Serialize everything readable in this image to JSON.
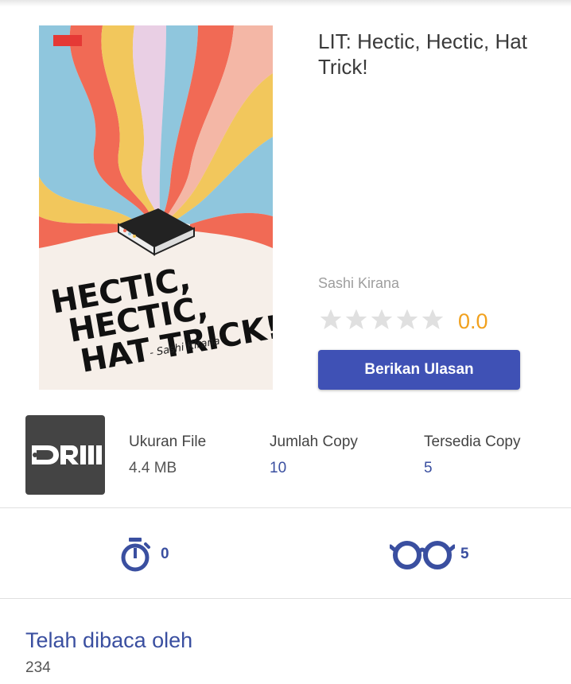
{
  "book": {
    "title": "LIT: Hectic, Hectic, Hat Trick!",
    "author": "Sashi Kirana",
    "rating": "0.0",
    "stars_filled": 0,
    "stars_total": 5,
    "review_button": "Berikan Ulasan",
    "cover": {
      "title_lines": [
        "HECTIC,",
        "HECTIC,",
        "HAT TRICK!"
      ],
      "author_line": "- Sashi Kirana",
      "publisher_logo": "gramedia-logo",
      "colors": [
        "#f16a55",
        "#8fc6dd",
        "#f2c75c",
        "#f4b7a6",
        "#e9cfe4",
        "#f6efe9"
      ]
    }
  },
  "drm_icon": {
    "icon": "drm-icon",
    "label": "DRM"
  },
  "stats": {
    "file_size_label": "Ukuran File",
    "file_size_value": "4.4 MB",
    "copies_label": "Jumlah Copy",
    "copies_value": "10",
    "available_label": "Tersedia Copy",
    "available_value": "5"
  },
  "metrics": {
    "timer_icon": "stopwatch-icon",
    "timer_value": "0",
    "readers_icon": "glasses-icon",
    "readers_value": "5"
  },
  "read_by": {
    "title": "Telah dibaca oleh",
    "count": "234"
  },
  "colors": {
    "primary": "#3f51b5",
    "accent_blue": "#3a4fa0",
    "rating": "#f1a11e",
    "star_empty": "#e0e0e0"
  }
}
